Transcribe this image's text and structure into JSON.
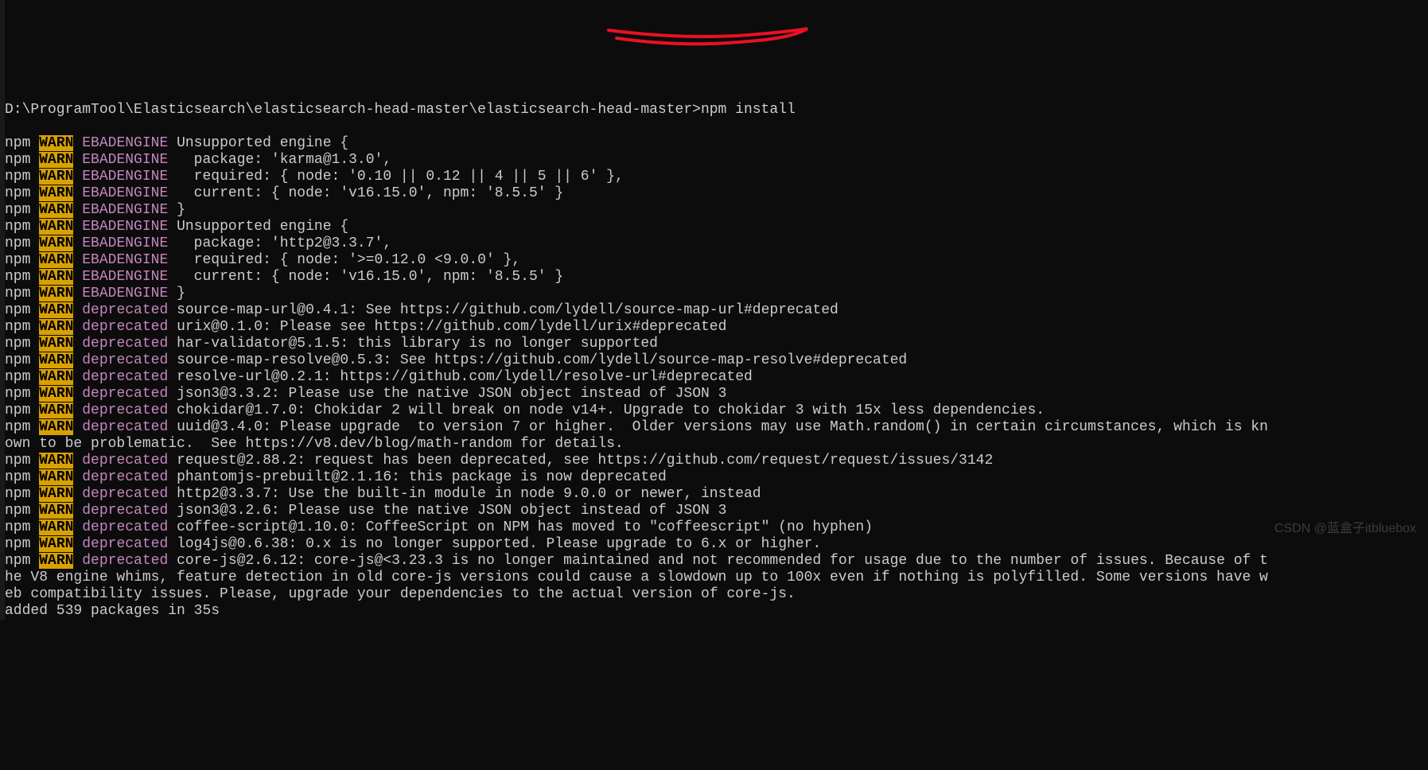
{
  "prompt": "D:\\ProgramTool\\Elasticsearch\\elasticsearch-head-master\\elasticsearch-head-master>npm install",
  "lines": [
    {
      "prefix": "npm",
      "level": "WARN",
      "code": "EBADENGINE",
      "msg": " Unsupported engine {"
    },
    {
      "prefix": "npm",
      "level": "WARN",
      "code": "EBADENGINE",
      "msg": "   package: 'karma@1.3.0',"
    },
    {
      "prefix": "npm",
      "level": "WARN",
      "code": "EBADENGINE",
      "msg": "   required: { node: '0.10 || 0.12 || 4 || 5 || 6' },"
    },
    {
      "prefix": "npm",
      "level": "WARN",
      "code": "EBADENGINE",
      "msg": "   current: { node: 'v16.15.0', npm: '8.5.5' }"
    },
    {
      "prefix": "npm",
      "level": "WARN",
      "code": "EBADENGINE",
      "msg": " }"
    },
    {
      "prefix": "npm",
      "level": "WARN",
      "code": "EBADENGINE",
      "msg": " Unsupported engine {"
    },
    {
      "prefix": "npm",
      "level": "WARN",
      "code": "EBADENGINE",
      "msg": "   package: 'http2@3.3.7',"
    },
    {
      "prefix": "npm",
      "level": "WARN",
      "code": "EBADENGINE",
      "msg": "   required: { node: '>=0.12.0 <9.0.0' },"
    },
    {
      "prefix": "npm",
      "level": "WARN",
      "code": "EBADENGINE",
      "msg": "   current: { node: 'v16.15.0', npm: '8.5.5' }"
    },
    {
      "prefix": "npm",
      "level": "WARN",
      "code": "EBADENGINE",
      "msg": " }"
    },
    {
      "prefix": "npm",
      "level": "WARN",
      "code": "deprecated",
      "msg": " source-map-url@0.4.1: See https://github.com/lydell/source-map-url#deprecated"
    },
    {
      "prefix": "npm",
      "level": "WARN",
      "code": "deprecated",
      "msg": " urix@0.1.0: Please see https://github.com/lydell/urix#deprecated"
    },
    {
      "prefix": "npm",
      "level": "WARN",
      "code": "deprecated",
      "msg": " har-validator@5.1.5: this library is no longer supported"
    },
    {
      "prefix": "npm",
      "level": "WARN",
      "code": "deprecated",
      "msg": " source-map-resolve@0.5.3: See https://github.com/lydell/source-map-resolve#deprecated"
    },
    {
      "prefix": "npm",
      "level": "WARN",
      "code": "deprecated",
      "msg": " resolve-url@0.2.1: https://github.com/lydell/resolve-url#deprecated"
    },
    {
      "prefix": "npm",
      "level": "WARN",
      "code": "deprecated",
      "msg": " json3@3.3.2: Please use the native JSON object instead of JSON 3"
    },
    {
      "prefix": "npm",
      "level": "WARN",
      "code": "deprecated",
      "msg": " chokidar@1.7.0: Chokidar 2 will break on node v14+. Upgrade to chokidar 3 with 15x less dependencies."
    },
    {
      "prefix": "npm",
      "level": "WARN",
      "code": "deprecated",
      "msg": " uuid@3.4.0: Please upgrade  to version 7 or higher.  Older versions may use Math.random() in certain circumstances, which is kn"
    },
    {
      "cont": "own to be problematic.  See https://v8.dev/blog/math-random for details."
    },
    {
      "prefix": "npm",
      "level": "WARN",
      "code": "deprecated",
      "msg": " request@2.88.2: request has been deprecated, see https://github.com/request/request/issues/3142"
    },
    {
      "prefix": "npm",
      "level": "WARN",
      "code": "deprecated",
      "msg": " phantomjs-prebuilt@2.1.16: this package is now deprecated"
    },
    {
      "prefix": "npm",
      "level": "WARN",
      "code": "deprecated",
      "msg": " http2@3.3.7: Use the built-in module in node 9.0.0 or newer, instead"
    },
    {
      "prefix": "npm",
      "level": "WARN",
      "code": "deprecated",
      "msg": " json3@3.2.6: Please use the native JSON object instead of JSON 3"
    },
    {
      "prefix": "npm",
      "level": "WARN",
      "code": "deprecated",
      "msg": " coffee-script@1.10.0: CoffeeScript on NPM has moved to \"coffeescript\" (no hyphen)"
    },
    {
      "prefix": "npm",
      "level": "WARN",
      "code": "deprecated",
      "msg": " log4js@0.6.38: 0.x is no longer supported. Please upgrade to 6.x or higher."
    },
    {
      "prefix": "npm",
      "level": "WARN",
      "code": "deprecated",
      "msg": " core-js@2.6.12: core-js@<3.23.3 is no longer maintained and not recommended for usage due to the number of issues. Because of t"
    },
    {
      "cont": "he V8 engine whims, feature detection in old core-js versions could cause a slowdown up to 100x even if nothing is polyfilled. Some versions have w"
    },
    {
      "cont": "eb compatibility issues. Please, upgrade your dependencies to the actual version of core-js."
    },
    {
      "cont": ""
    },
    {
      "cont": "added 539 packages in 35s"
    }
  ],
  "watermark": "CSDN @蓝盒子itbluebox"
}
